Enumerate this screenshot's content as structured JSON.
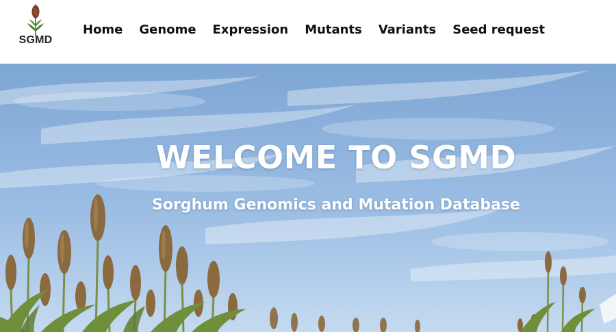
{
  "header": {
    "logo_text": "SGMD",
    "nav": [
      {
        "label": "Home"
      },
      {
        "label": "Genome"
      },
      {
        "label": "Expression"
      },
      {
        "label": "Mutants"
      },
      {
        "label": "Variants"
      },
      {
        "label": "Seed request"
      }
    ]
  },
  "hero": {
    "title": "WELCOME TO SGMD",
    "subtitle": "Sorghum Genomics and Mutation Database",
    "background": "sky-with-sorghum-field-photo"
  },
  "colors": {
    "nav_text": "#111111",
    "hero_text": "#ffffff",
    "sky": "#8fb4de",
    "sorghum_head": "#7a5a3a",
    "leaf_green": "#6f8f3a"
  }
}
